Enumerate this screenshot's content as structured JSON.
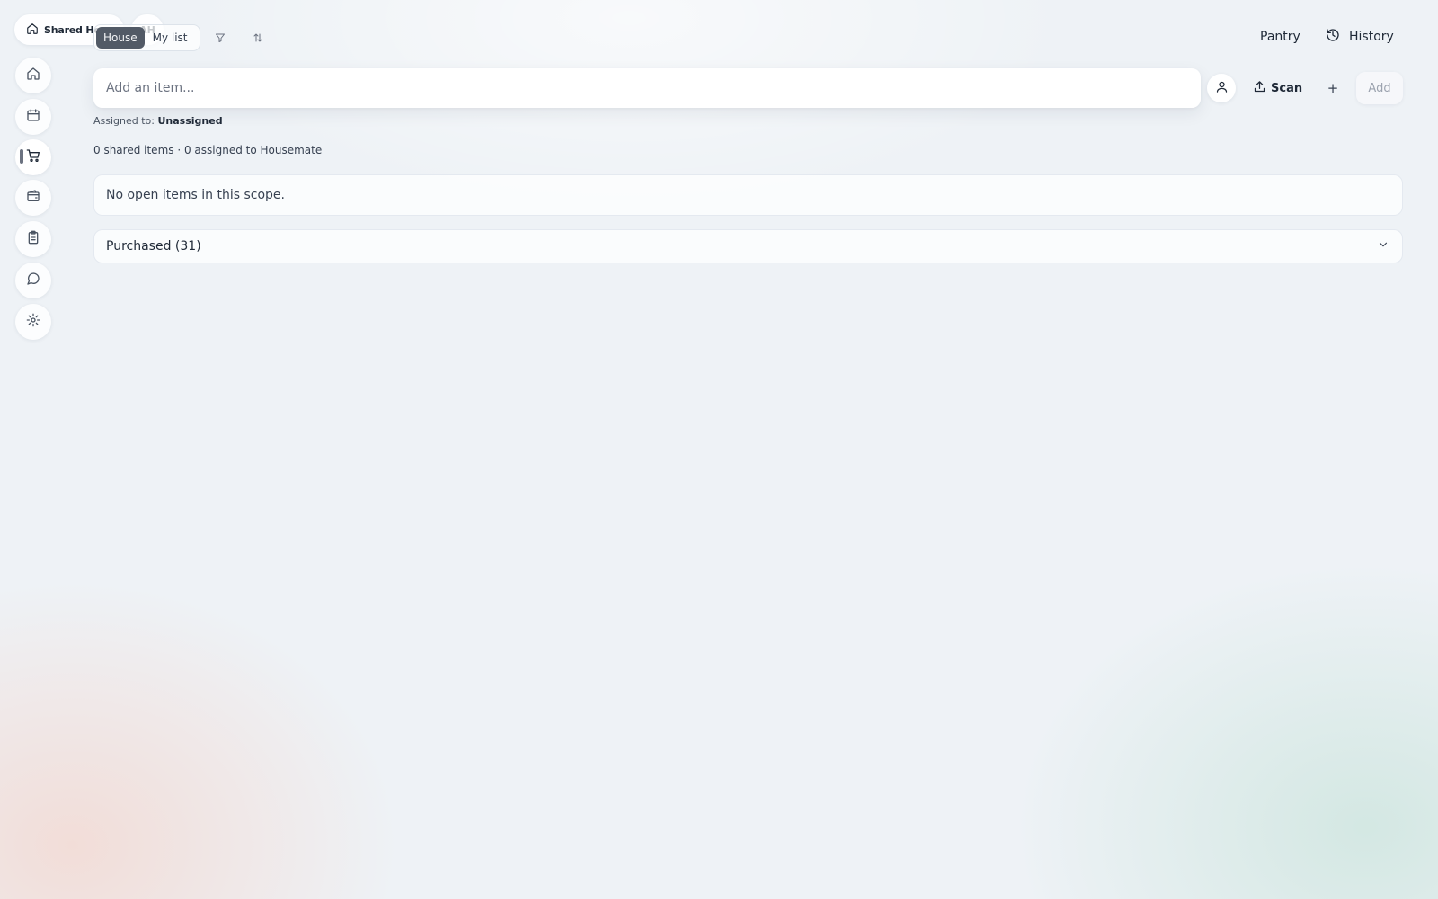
{
  "header": {
    "household_label": "Shared House",
    "user_initials": "AH",
    "scope_tabs": [
      "House",
      "My list"
    ],
    "active_scope": "House",
    "pantry_label": "Pantry",
    "history_label": "History"
  },
  "sidebar": {
    "items": [
      {
        "icon": "home-icon"
      },
      {
        "icon": "calendar-icon"
      },
      {
        "icon": "cart-icon",
        "active": true
      },
      {
        "icon": "wallet-icon"
      },
      {
        "icon": "clipboard-icon"
      },
      {
        "icon": "chat-icon"
      },
      {
        "icon": "gear-icon"
      }
    ]
  },
  "add_item": {
    "placeholder": "Add an item...",
    "scan_label": "Scan",
    "plus_label": "+",
    "add_label": "Add",
    "assigned_prefix": "Assigned to:",
    "assigned_value": "Unassigned"
  },
  "list": {
    "summary": "0 shared items · 0 assigned to Housemate",
    "empty_message": "No open items in this scope.",
    "purchased_label": "Purchased (31)"
  },
  "colors": {
    "active_tab_bg": "#525a66",
    "text_primary": "#1f2937",
    "background": "#eef2f6"
  }
}
